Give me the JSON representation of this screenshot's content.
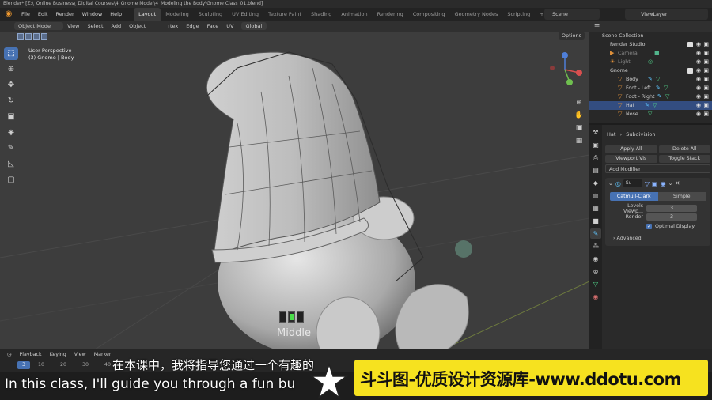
{
  "window": {
    "title": "Blender* [Z:\\_Online Business\\_Digital Courses\\4_Gnome Model\\4_Modeling the Body\\Gnome Class_01.blend]"
  },
  "menu": {
    "items": [
      "File",
      "Edit",
      "Render",
      "Window",
      "Help"
    ]
  },
  "workspaces": {
    "tabs": [
      "Layout",
      "Modeling",
      "Sculpting",
      "UV Editing",
      "Texture Paint",
      "Shading",
      "Animation",
      "Rendering",
      "Compositing",
      "Geometry Nodes",
      "Scripting"
    ],
    "active": "Layout"
  },
  "scene": {
    "label": "Scene"
  },
  "view_layer": {
    "label": "ViewLayer"
  },
  "viewport": {
    "mode": "Object Mode",
    "menu": [
      "View",
      "Select",
      "Add",
      "Object"
    ],
    "menu2": [
      "rtex",
      "Edge",
      "Face",
      "UV"
    ],
    "orientation": "Global",
    "options": "Options",
    "overlay_line1": "User Perspective",
    "overlay_line2": "(3) Gnome | Body",
    "key_label": "Middle"
  },
  "outliner": {
    "rows": [
      {
        "label": "Scene Collection"
      },
      {
        "label": "Render Studio"
      },
      {
        "label": "Camera"
      },
      {
        "label": "Light"
      },
      {
        "label": "Gnome"
      },
      {
        "label": "Body"
      },
      {
        "label": "Foot - Left"
      },
      {
        "label": "Foot - Right"
      },
      {
        "label": "Hat"
      },
      {
        "label": "Nose"
      }
    ]
  },
  "properties": {
    "object": "Hat",
    "modifier_type": "Subdivision",
    "apply_all": "Apply All",
    "delete_all": "Delete All",
    "viewport_vis": "Viewport Vis",
    "toggle_stack": "Toggle Stack",
    "add_modifier": "Add Modifier",
    "mod_name": "Su",
    "algo_catmull": "Catmull-Clark",
    "algo_simple": "Simple",
    "levels_label": "Levels Viewp...",
    "levels_value": "3",
    "render_label": "Render",
    "render_value": "3",
    "optimal_display": "Optimal Display",
    "advanced": "Advanced"
  },
  "timeline": {
    "menu": [
      "Playback",
      "Keying",
      "View",
      "Marker"
    ],
    "current_frame": "3",
    "ticks": [
      "10",
      "20",
      "30",
      "40"
    ]
  },
  "subtitles": {
    "chinese": "在本课中，我将指导您通过一个有趣的",
    "english": "In this class, I'll guide you through a fun bu"
  },
  "watermark": {
    "text": "斗斗图-优质设计资源库-www.ddotu.com"
  },
  "colors": {
    "accent": "#4772b3",
    "banner": "#f6e21f",
    "viewport_bg": "#3d3d3d"
  }
}
